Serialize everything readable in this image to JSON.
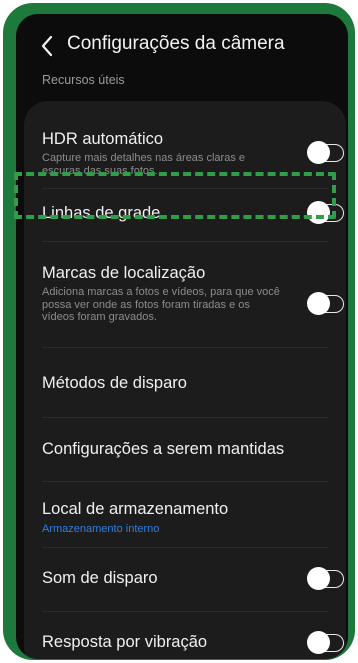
{
  "header": {
    "back_icon": "chevron-left-icon",
    "title": "Configurações da câmera"
  },
  "section": {
    "label": "Recursos úteis"
  },
  "settings": [
    {
      "label": "HDR automático",
      "description": "Capture mais detalhes nas áreas claras e escuras das suas fotos.",
      "toggle": "off"
    },
    {
      "label": "Linhas de grade",
      "toggle": "off",
      "highlighted": true
    },
    {
      "label": "Marcas de localização",
      "description": "Adiciona marcas a fotos e vídeos, para que você possa ver onde as fotos foram tiradas e os vídeos foram gravados.",
      "toggle": "off"
    },
    {
      "label": "Métodos de disparo"
    },
    {
      "label": "Configurações a serem mantidas"
    },
    {
      "label": "Local de armazenamento",
      "value": "Armazenamento interno"
    },
    {
      "label": "Som de disparo",
      "toggle": "off"
    },
    {
      "label": "Resposta por vibração",
      "toggle": "off"
    }
  ],
  "colors": {
    "frame": "#1e7a3c",
    "highlight": "#2e9e4a",
    "background": "#0c0c0c",
    "card": "#1c1c1c",
    "link_text": "#2f7fe0"
  }
}
